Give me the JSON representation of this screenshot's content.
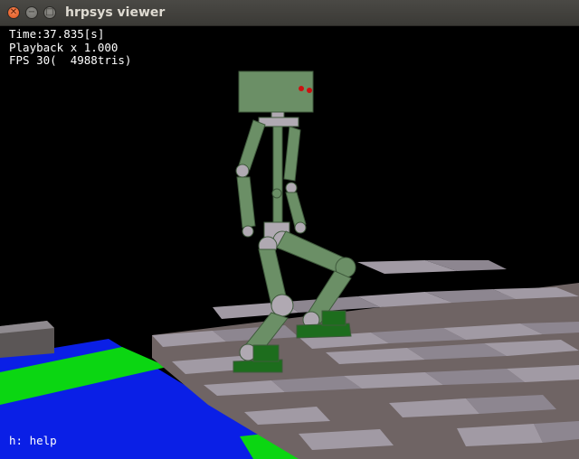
{
  "window": {
    "title": "hrpsys viewer",
    "close_glyph": "✕",
    "minimize_glyph": "−",
    "maximize_glyph": "□"
  },
  "hud": {
    "time": "Time:37.835[s]",
    "playback": "Playback x 1.000",
    "fps": "FPS 30(  4988tris)"
  },
  "help": "h: help",
  "colors": {
    "background": "#000000",
    "floor_blue": "#0a1fe6",
    "floor_green": "#0bd612",
    "stair_light": "#a19aa4",
    "stair_dark": "#6f6464",
    "robot_body": "#6b8f66",
    "robot_joint": "#b0a9b2",
    "robot_foot": "#1d6d1d",
    "robot_eye": "#cc1111"
  }
}
